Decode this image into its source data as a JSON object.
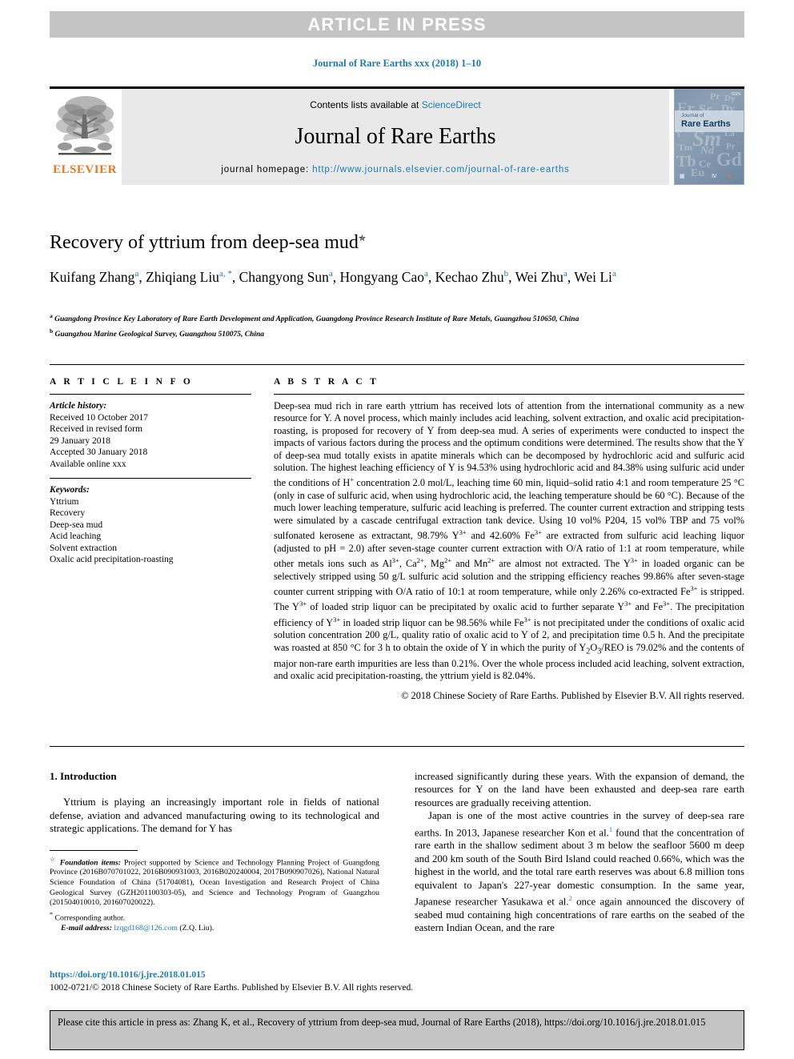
{
  "banner": {
    "text": "ARTICLE IN PRESS"
  },
  "running_head": {
    "text": "Journal of Rare Earths xxx (2018) 1–10"
  },
  "masthead": {
    "contents_prefix": "Contents lists available at ",
    "sciencedirect": "ScienceDirect",
    "journal_title": "Journal of Rare Earths",
    "homepage_prefix": "journal homepage: ",
    "homepage_url": "http://www.journals.elsevier.com/journal-of-rare-earths",
    "publisher": "ELSEVIER",
    "cover": {
      "journal_of": "Journal of",
      "rare_earths": "Rare Earths",
      "top_right": "ISSN",
      "elements": [
        "Pr",
        "Dy",
        "Er",
        "Sc",
        "Dy",
        "Y",
        "Sm",
        "La",
        "Tm",
        "Pr",
        "Nd",
        "Tb",
        "Ce",
        "Gd",
        "Eu",
        "Pm"
      ]
    }
  },
  "article": {
    "title": "Recovery of yttrium from deep-sea mud",
    "title_mark": "✯",
    "authors": [
      {
        "name": "Kuifang Zhang",
        "marks": "a"
      },
      {
        "name": "Zhiqiang Liu",
        "marks": "a, *"
      },
      {
        "name": "Changyong Sun",
        "marks": "a"
      },
      {
        "name": "Hongyang Cao",
        "marks": "a"
      },
      {
        "name": "Kechao Zhu",
        "marks": "b"
      },
      {
        "name": "Wei Zhu",
        "marks": "a"
      },
      {
        "name": "Wei Li",
        "marks": "a"
      }
    ],
    "affiliations": [
      {
        "mark": "a",
        "text": "Guangdong Province Key Laboratory of Rare Earth Development and Application, Guangdong Province Research Institute of Rare Metals, Guangzhou 510650, China"
      },
      {
        "mark": "b",
        "text": "Guangzhou Marine Geological Survey, Guangzhou 510075, China"
      }
    ]
  },
  "article_info": {
    "label": "A R T I C L E  I N F O",
    "history_heading": "Article history:",
    "history_lines": [
      "Received 10 October 2017",
      "Received in revised form",
      "29 January 2018",
      "Accepted 30 January 2018",
      "Available online xxx"
    ],
    "keywords_heading": "Keywords:",
    "keywords": [
      "Yttrium",
      "Recovery",
      "Deep-sea mud",
      "Acid leaching",
      "Solvent extraction",
      "Oxalic acid precipitation-roasting"
    ]
  },
  "abstract": {
    "label": "A B S T R A C T",
    "paragraphs": [
      "Deep-sea mud rich in rare earth yttrium has received lots of attention from the international community as a new resource for Y. A novel process, which mainly includes acid leaching, solvent extraction, and oxalic acid precipitation-roasting, is proposed for recovery of Y from deep-sea mud. A series of experiments were conducted to inspect the impacts of various factors during the process and the optimum conditions were determined. The results show that the Y of deep-sea mud totally exists in apatite minerals which can be decomposed by hydrochloric acid and sulfuric acid solution. The highest leaching efficiency of Y is 94.53% using hydrochloric acid and 84.38% using sulfuric acid under the conditions of H+ concentration 2.0 mol/L, leaching time 60 min, liquid–solid ratio 4:1 and room temperature 25 °C (only in case of sulfuric acid, when using hydrochloric acid, the leaching temperature should be 60 °C). Because of the much lower leaching temperature, sulfuric acid leaching is preferred. The counter current extraction and stripping tests were simulated by a cascade centrifugal extraction tank device. Using 10 vol% P204, 15 vol% TBP and 75 vol% sulfonated kerosene as extractant, 98.79% Y3+ and 42.60% Fe3+ are extracted from sulfuric acid leaching liquor (adjusted to pH = 2.0) after seven-stage counter current extraction with O/A ratio of 1:1 at room temperature, while other metals ions such as Al3+, Ca2+, Mg2+ and Mn2+ are almost not extracted. The Y3+ in loaded organic can be selectively stripped using 50 g/L sulfuric acid solution and the stripping efficiency reaches 99.86% after seven-stage counter current stripping with O/A ratio of 10:1 at room temperature, while only 2.26% co-extracted Fe3+ is stripped. The Y3+ of loaded strip liquor can be precipitated by oxalic acid to further separate Y3+ and Fe3+. The precipitation efficiency of Y3+ in loaded strip liquor can be 98.56% while Fe3+ is not precipitated under the conditions of oxalic acid solution concentration 200 g/L, quality ratio of oxalic acid to Y of 2, and precipitation time 0.5 h. And the precipitate was roasted at 850 °C for 3 h to obtain the oxide of Y in which the purity of Y2O3/REO is 79.02% and the contents of major non-rare earth impurities are less than 0.21%. Over the whole process included acid leaching, solvent extraction, and oxalic acid precipitation-roasting, the yttrium yield is 82.04%."
    ],
    "copyright": "© 2018 Chinese Society of Rare Earths. Published by Elsevier B.V. All rights reserved."
  },
  "introduction": {
    "heading": "1. Introduction",
    "left_paragraph": "Yttrium is playing an increasingly important role in fields of national defense, aviation and advanced manufacturing owing to its technological and strategic applications. The demand for Y has",
    "right_paragraph_1": "increased significantly during these years. With the expansion of demand, the resources for Y on the land have been exhausted and deep-sea rare earth resources are gradually receiving attention.",
    "right_paragraph_2_a": "Japan is one of the most active countries in the survey of deep-sea rare earths. In 2013, Japanese researcher Kon et al.",
    "right_ref_1": "1",
    "right_paragraph_2_b": " found that the concentration of rare earth in the shallow sediment about 3 m below the seafloor 5600 m deep and 200 km south of the South Bird Island could reached 0.66%, which was the highest in the world, and the total rare earth reserves was about 6.8 million tons equivalent to Japan's 227-year domestic consumption. In the same year, Japanese researcher Yasukawa et al.",
    "right_ref_2": "2",
    "right_paragraph_2_c": " once again announced the discovery of seabed mud containing high concentrations of rare earths on the seabed of the eastern Indian Ocean, and the rare"
  },
  "footnotes": {
    "star": "☆",
    "foundation_label": "Foundation items:",
    "foundation_text": " Project supported by Science and Technology Planning Project of Guangdong Province (2016B070701022, 2016B090931003, 2016B020240004, 2017B090907026), National Natural Science Foundation of China (51704081), Ocean Investigation and Research Project of China Geological Survey (GZH201100303-05), and Science and Technology Program of Guangzhou (201504010010, 201607020022).",
    "corresponding": "Corresponding author.",
    "email_label": "E-mail address:",
    "email": "lzqgd168@126.com",
    "email_suffix": " (Z.Q. Liu)."
  },
  "doi": {
    "url": "https://doi.org/10.1016/j.jre.2018.01.015"
  },
  "issn": {
    "text": "1002-0721/© 2018 Chinese Society of Rare Earths. Published by Elsevier B.V. All rights reserved."
  },
  "cite_box": {
    "text": "Please cite this article in press as: Zhang K, et al., Recovery of yttrium from deep-sea mud, Journal of Rare Earths (2018), https://doi.org/10.1016/j.jre.2018.01.015"
  },
  "colors": {
    "link": "#1a7bb0",
    "banner_bg": "#c4c4c4",
    "masthead_bg": "#e9e9e9",
    "elsevier_orange": "#e87722"
  }
}
